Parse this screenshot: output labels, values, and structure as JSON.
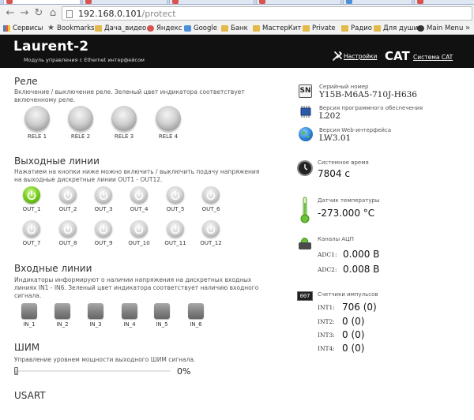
{
  "browser": {
    "url_host": "192.168.0.101",
    "url_path": "/protect",
    "bookmarks": [
      "Сервисы",
      "Bookmarks",
      "Дача_видео",
      "Яндекс",
      "Google",
      "Банк",
      "МастерКит",
      "Private",
      "Радио",
      "Для души",
      "Main Menu"
    ],
    "more": "»"
  },
  "header": {
    "brand": "Laurent-2",
    "subtitle": "Модуль управления с Ethernet интерфейсом",
    "settings_label": "Настройки",
    "cat_logo": "CAT",
    "cat_label": "Система CAT"
  },
  "relays": {
    "title": "Реле",
    "description": "Включение / выключение реле. Зеленый цвет индикатора соответствует включенному реле.",
    "items": [
      {
        "label": "RELE 1",
        "on": false
      },
      {
        "label": "RELE 2",
        "on": false
      },
      {
        "label": "RELE 3",
        "on": false
      },
      {
        "label": "RELE 4",
        "on": false
      }
    ]
  },
  "outputs": {
    "title": "Выходные линии",
    "description": "Нажатием на кнопки ниже можно включить / выключить подачу напряжения на выходные дискретные линии OUT1 - OUT12.",
    "items": [
      {
        "label": "OUT_1",
        "on": true
      },
      {
        "label": "OUT_2",
        "on": false
      },
      {
        "label": "OUT_3",
        "on": false
      },
      {
        "label": "OUT_4",
        "on": false
      },
      {
        "label": "OUT_5",
        "on": false
      },
      {
        "label": "OUT_6",
        "on": false
      },
      {
        "label": "OUT_7",
        "on": false
      },
      {
        "label": "OUT_8",
        "on": false
      },
      {
        "label": "OUT_9",
        "on": false
      },
      {
        "label": "OUT_10",
        "on": false
      },
      {
        "label": "OUT_11",
        "on": false
      },
      {
        "label": "OUT_12",
        "on": false
      }
    ]
  },
  "inputs": {
    "title": "Входные линии",
    "description": "Индикаторы информируют о наличии напряжения на дискретных входных линиях IN1 - IN6. Зеленый цвет индикатора соответствует наличию входного сигнала.",
    "items": [
      {
        "label": "IN_1",
        "on": false
      },
      {
        "label": "IN_2",
        "on": false
      },
      {
        "label": "IN_3",
        "on": false
      },
      {
        "label": "IN_4",
        "on": false
      },
      {
        "label": "IN_5",
        "on": false
      },
      {
        "label": "IN_6",
        "on": false
      }
    ]
  },
  "pwm": {
    "title": "ШИМ",
    "description": "Управление уровнем мощности выходного ШИМ сигнала.",
    "value_text": "0%",
    "level": 0
  },
  "usart": {
    "title": "USART"
  },
  "info": {
    "serial_icon_text": "SN",
    "serial_label": "Серийный номер",
    "serial_value": "Y15B-M6A5-710J-H636",
    "fw_label": "Версия программного обеспечения",
    "fw_value": "L202",
    "web_label": "Версия Web-интерфейса",
    "web_value": "LW3.01",
    "time_label": "Системное время",
    "time_value": "7804 с",
    "temp_label": "Датчик температуры",
    "temp_value": "-273.000 °C",
    "adc_label": "Каналы АЦП",
    "adc": [
      {
        "key": "ADC1:",
        "value": "0.000 В"
      },
      {
        "key": "ADC2:",
        "value": "0.008 В"
      }
    ],
    "counter_label": "Счетчики импульсов",
    "counter_icon_text": "007",
    "counters": [
      {
        "key": "INT1:",
        "value": "706 (0)"
      },
      {
        "key": "INT2:",
        "value": "0 (0)"
      },
      {
        "key": "INT3:",
        "value": "0 (0)"
      },
      {
        "key": "INT4:",
        "value": "0 (0)"
      }
    ]
  },
  "colors": {
    "on": "#7ed321",
    "off": "#bdbdbd",
    "header_bg": "#111111"
  }
}
